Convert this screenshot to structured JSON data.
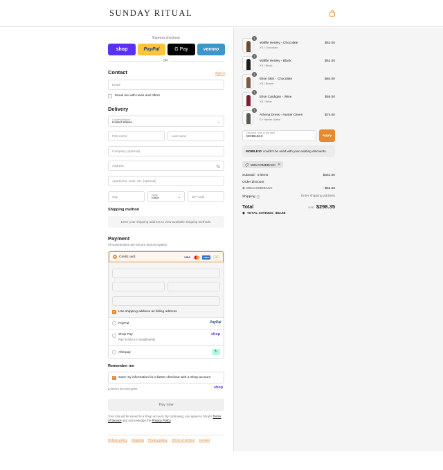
{
  "header": {
    "logo": "SUNDAY RITUAL",
    "cart_icon": "shopping-bag-icon"
  },
  "express": {
    "title": "Express checkout",
    "or": "OR",
    "buttons": [
      {
        "label": "shop",
        "bg": "#5a31f4",
        "color": "#ffffff"
      },
      {
        "label": "PayPal",
        "bg": "#ffc439",
        "color": "#253b80"
      },
      {
        "label": "G Pay",
        "bg": "#000000",
        "color": "#ffffff"
      },
      {
        "label": "venmo",
        "bg": "#3d95ce",
        "color": "#ffffff"
      }
    ]
  },
  "contact": {
    "heading": "Contact",
    "sign_in": "Sign in",
    "email_placeholder": "Email",
    "news_label": "Email me with news and offers"
  },
  "delivery": {
    "heading": "Delivery",
    "country_label": "Country/Region",
    "country_value": "United States",
    "first_name": "First name",
    "last_name": "Last name",
    "company": "Company (optional)",
    "address": "Address",
    "apartment": "Apartment, suite, etc. (optional)",
    "city": "City",
    "state_label": "State",
    "state_value": "Iowa",
    "zip": "ZIP code"
  },
  "shipping": {
    "heading": "Shipping method",
    "message": "Enter your shipping address to view available shipping methods."
  },
  "payment": {
    "heading": "Payment",
    "subtitle": "All transactions are secure and encrypted.",
    "credit_card": "Credit card",
    "more_cards": "+5",
    "billing_same": "Use shipping address as billing address",
    "paypal": "PayPal",
    "shop_pay": "Shop Pay",
    "shop_pay_sub": "Pay in full or in installments",
    "afterpay": "Afterpay"
  },
  "remember": {
    "heading": "Remember me",
    "save_label": "Save my information for a faster checkout with a Shop account",
    "secure": "Secure and encrypted",
    "shop_brand": "shop"
  },
  "pay_now": "Pay now",
  "terms": {
    "line1": "Your info will be saved to a Shop account. By continuing, you agree to Shop's",
    "tos": "Terms of Service",
    "mid": " and acknowledge the ",
    "privacy": "Privacy Policy",
    "end": "."
  },
  "footer": [
    "Refund policy",
    "Shipping",
    "Privacy policy",
    "Terms of service",
    "Contact"
  ],
  "cart": {
    "items": [
      {
        "qty": "1",
        "name": "Waffle Henley - Chocolate",
        "variant": "XS / Chocolate",
        "price": "$62.00",
        "color": "#6b4a34"
      },
      {
        "qty": "1",
        "name": "Waffle Henley - Black",
        "variant": "XS / Black",
        "price": "$62.00",
        "color": "#1c1c1c"
      },
      {
        "qty": "1",
        "name": "Elise Skirt - Chocolate",
        "variant": "XS / Brown",
        "price": "$84.00",
        "color": "#7a5a40"
      },
      {
        "qty": "1",
        "name": "Elise Cardigan - Wine",
        "variant": "XS / Wine",
        "price": "$68.00",
        "color": "#7d1f2a"
      },
      {
        "qty": "1",
        "name": "Athena Dress - Hunter Green",
        "variant": "S / Hunter Green",
        "price": "$75.00",
        "color": "#5a5a4a"
      }
    ],
    "discount_label": "Discount code or gift card",
    "discount_value": "MOBILE10",
    "apply": "Apply",
    "notice_code": "MOBILE10",
    "notice_text": "couldn't be used with your existing discounts.",
    "chip": "WELCOMEBACK",
    "subtotal_label": "Subtotal · 5 items",
    "subtotal_value": "$351.00",
    "order_discount": "Order discount",
    "discount_code": "WELCOMEBACK",
    "discount_amount": "- $52.65",
    "shipping_label": "Shipping",
    "shipping_value": "Enter shipping address",
    "total_label": "Total",
    "currency": "USD",
    "total_value": "$298.35",
    "savings_label": "TOTAL SAVINGS",
    "savings_value": "$52.65"
  },
  "colors": {
    "accent": "#e8892c",
    "panel": "#f5f5f5"
  }
}
